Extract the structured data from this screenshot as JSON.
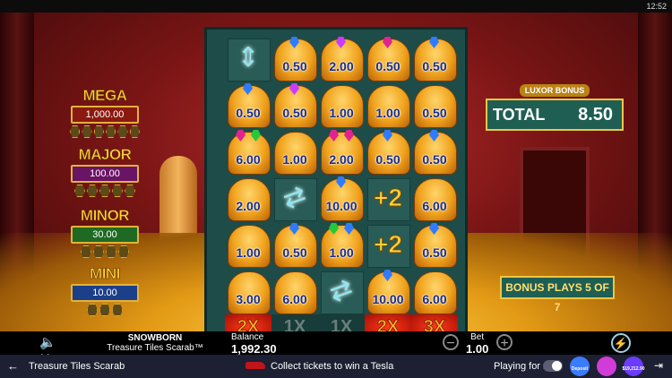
{
  "status_bar": {
    "time": "12:52"
  },
  "jackpots": [
    {
      "name": "MEGA",
      "value": "1,000.00",
      "color": "#ffd23a",
      "box": "#8a1a10",
      "gems": 6
    },
    {
      "name": "MAJOR",
      "value": "100.00",
      "color": "#ffd23a",
      "box": "#6a1466",
      "gems": 5
    },
    {
      "name": "MINOR",
      "value": "30.00",
      "color": "#ffd23a",
      "box": "#1e6a22",
      "gems": 4
    },
    {
      "name": "MINI",
      "value": "10.00",
      "color": "#ffd23a",
      "box": "#1c3f8a",
      "gems": 3
    }
  ],
  "grid": [
    [
      {
        "t": "arrow-v"
      },
      {
        "t": "scarab",
        "v": "0.50",
        "g": [
          "#2f7bff"
        ]
      },
      {
        "t": "scarab",
        "v": "2.00",
        "g": [
          "#c83cff"
        ]
      },
      {
        "t": "scarab",
        "v": "0.50",
        "g": [
          "#e0238f"
        ]
      },
      {
        "t": "scarab",
        "v": "0.50",
        "g": [
          "#2f7bff"
        ]
      }
    ],
    [
      {
        "t": "scarab",
        "v": "0.50",
        "g": [
          "#2f7bff"
        ]
      },
      {
        "t": "scarab",
        "v": "0.50",
        "g": [
          "#c83cff"
        ]
      },
      {
        "t": "scarab",
        "v": "1.00",
        "g": []
      },
      {
        "t": "scarab",
        "v": "1.00",
        "g": []
      },
      {
        "t": "scarab",
        "v": "0.50",
        "g": []
      }
    ],
    [
      {
        "t": "scarab",
        "v": "6.00",
        "g": [
          "#e0238f",
          "#23c93a"
        ]
      },
      {
        "t": "scarab",
        "v": "1.00",
        "g": []
      },
      {
        "t": "scarab",
        "v": "2.00",
        "g": [
          "#e0238f",
          "#e0238f"
        ]
      },
      {
        "t": "scarab",
        "v": "0.50",
        "g": [
          "#2f7bff"
        ]
      },
      {
        "t": "scarab",
        "v": "0.50",
        "g": [
          "#2f7bff"
        ]
      }
    ],
    [
      {
        "t": "scarab",
        "v": "2.00",
        "g": []
      },
      {
        "t": "arrow-h"
      },
      {
        "t": "scarab",
        "v": "10.00",
        "g": [
          "#2f7bff"
        ]
      },
      {
        "t": "plus",
        "v": "+2"
      },
      {
        "t": "scarab",
        "v": "6.00",
        "g": []
      }
    ],
    [
      {
        "t": "scarab",
        "v": "1.00",
        "g": []
      },
      {
        "t": "scarab",
        "v": "0.50",
        "g": [
          "#2f7bff"
        ]
      },
      {
        "t": "scarab",
        "v": "1.00",
        "g": [
          "#23c93a",
          "#2f7bff"
        ]
      },
      {
        "t": "plus",
        "v": "+2"
      },
      {
        "t": "scarab",
        "v": "0.50",
        "g": [
          "#2f7bff"
        ]
      }
    ],
    [
      {
        "t": "scarab",
        "v": "3.00",
        "g": []
      },
      {
        "t": "scarab",
        "v": "6.00",
        "g": []
      },
      {
        "t": "arrow-h"
      },
      {
        "t": "scarab",
        "v": "10.00",
        "g": [
          "#2f7bff"
        ]
      },
      {
        "t": "scarab",
        "v": "6.00",
        "g": []
      }
    ]
  ],
  "multipliers": [
    {
      "label": "2X",
      "active": true
    },
    {
      "label": "1X",
      "active": false
    },
    {
      "label": "1X",
      "active": false
    },
    {
      "label": "2X",
      "active": true
    },
    {
      "label": "3X",
      "active": true
    }
  ],
  "luxor_bonus": {
    "title": "LUXOR BONUS",
    "label": "TOTAL",
    "value": "8.50"
  },
  "bonus_plays": "BONUS PLAYS 5 OF 7",
  "footer": {
    "brand_line1": "SNOWBORN",
    "brand_line2": "Treasure Tiles Scarab™",
    "balance_label": "Balance",
    "balance_value": "1,992.30",
    "bet_label": "Bet",
    "bet_value": "1.00",
    "minus": "−",
    "plus": "+",
    "turbo_icon": "⚡",
    "mute_icon": "🔈✕"
  },
  "app_bar": {
    "back_icon": "←",
    "title": "Treasure Tiles Scarab",
    "promo_text": "Collect tickets to win a Tesla",
    "real_label": "Playing for real",
    "promos": [
      {
        "caption": "Deposit",
        "color": "#3b7bff"
      },
      {
        "caption": "",
        "color": "#d13cd8"
      },
      {
        "caption": "$19,212.90",
        "color": "#6a3cff"
      }
    ],
    "exit_icon": "⇥"
  }
}
